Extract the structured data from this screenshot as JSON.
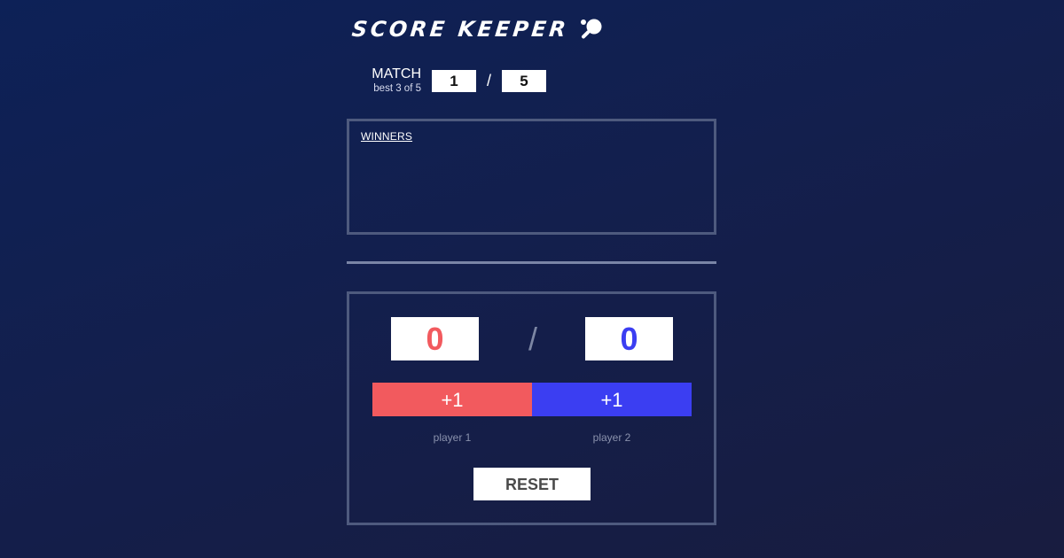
{
  "app": {
    "title": "SCORE KEEPER",
    "icon": "ping-pong-paddle-icon"
  },
  "match": {
    "label": "MATCH",
    "sub_label": "best 3 of 5",
    "current": "1",
    "separator": "/",
    "total": "5"
  },
  "winners": {
    "label": "WINNERS",
    "entries": []
  },
  "scores": {
    "player1": "0",
    "separator": "/",
    "player2": "0"
  },
  "buttons": {
    "player1_increment": "+1",
    "player2_increment": "+1",
    "reset": "RESET"
  },
  "players": {
    "player1_label": "player 1",
    "player2_label": "player 2"
  },
  "colors": {
    "background_start": "#0d2157",
    "background_end": "#181c3f",
    "player1": "#f25a5e",
    "player2": "#3b3ef2",
    "border": "#4e5a7e",
    "muted_text": "#8a92ad"
  }
}
